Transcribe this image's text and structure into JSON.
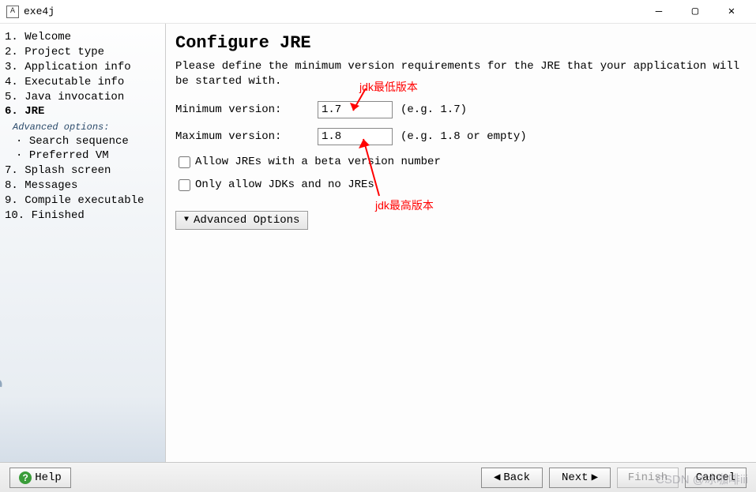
{
  "window": {
    "title": "exe4j",
    "app_icon_glyph": "A",
    "min": "—",
    "max": "▢",
    "close": "✕"
  },
  "sidebar": {
    "items": [
      {
        "num": "1.",
        "label": "Welcome"
      },
      {
        "num": "2.",
        "label": "Project type"
      },
      {
        "num": "3.",
        "label": "Application info"
      },
      {
        "num": "4.",
        "label": "Executable info"
      },
      {
        "num": "5.",
        "label": "Java invocation"
      },
      {
        "num": "6.",
        "label": "JRE",
        "current": true
      },
      {
        "num": "7.",
        "label": "Splash screen"
      },
      {
        "num": "8.",
        "label": "Messages"
      },
      {
        "num": "9.",
        "label": "Compile executable"
      },
      {
        "num": "10.",
        "label": "Finished"
      }
    ],
    "advanced_header": "Advanced options:",
    "advanced_items": [
      "Search sequence",
      "Preferred VM"
    ],
    "brand": "exe4j"
  },
  "page": {
    "title": "Configure JRE",
    "description": "Please define the minimum version requirements for the JRE that your application will be started with.",
    "min_label": "Minimum version:",
    "min_value": "1.7",
    "min_hint": "(e.g. 1.7)",
    "max_label": "Maximum version:",
    "max_value": "1.8",
    "max_hint": "(e.g. 1.8 or empty)",
    "check_beta": "Allow JREs with a beta version number",
    "check_jdk": "Only allow JDKs and no JREs",
    "advanced_button": "Advanced Options"
  },
  "annotations": {
    "anno1": "jdk最低版本",
    "anno2": "jdk最高版本"
  },
  "footer": {
    "help": "Help",
    "back": "Back",
    "next": "Next",
    "finish": "Finish",
    "cancel": "Cancel"
  },
  "watermark": "CSDN @冰咖啡iii"
}
